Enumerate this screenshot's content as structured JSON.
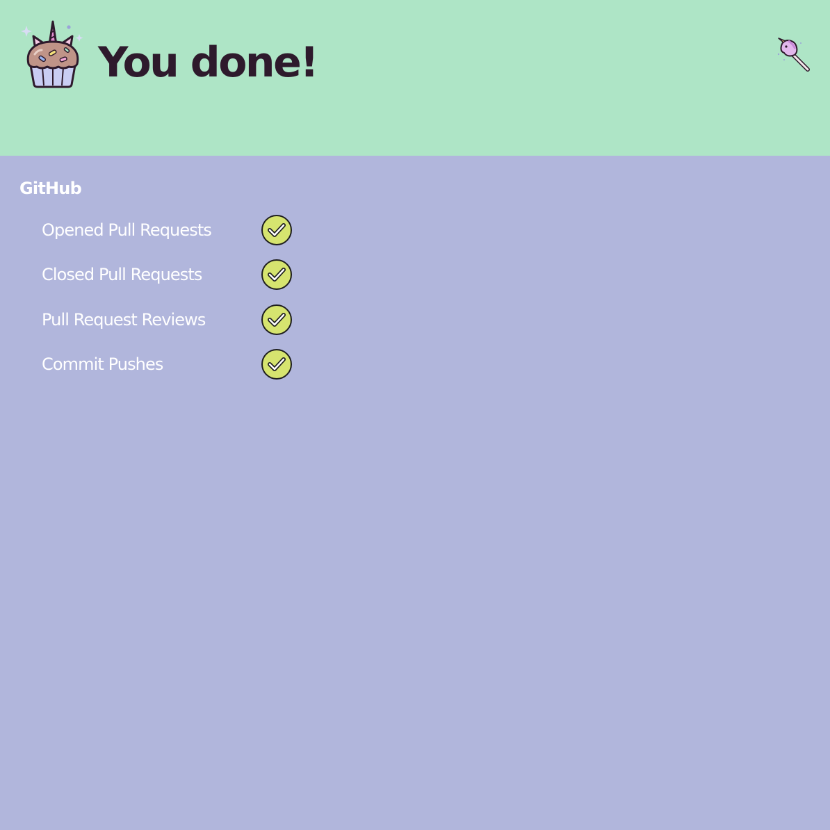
{
  "header": {
    "title": "You done!",
    "logo_icon": "unicorn-cupcake-icon",
    "wand_icon": "unicorn-wand-icon"
  },
  "colors": {
    "header_bg": "#aee5c6",
    "content_bg": "#b1b6dc",
    "title_color": "#2e1a2c",
    "check_fill": "#d6e46f"
  },
  "section": {
    "title": "GitHub",
    "items": [
      {
        "label": "Opened Pull Requests",
        "status_icon": "check-circle-icon"
      },
      {
        "label": "Closed Pull Requests",
        "status_icon": "check-circle-icon"
      },
      {
        "label": "Pull Request Reviews",
        "status_icon": "check-circle-icon"
      },
      {
        "label": "Commit Pushes",
        "status_icon": "check-circle-icon"
      }
    ]
  }
}
